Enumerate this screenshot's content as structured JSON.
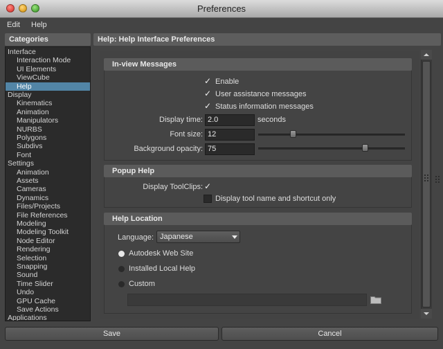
{
  "window": {
    "title": "Preferences"
  },
  "menubar": {
    "items": [
      "Edit",
      "Help"
    ]
  },
  "categories": {
    "header": "Categories",
    "items": [
      {
        "label": "Interface",
        "level": 0
      },
      {
        "label": "Interaction Mode",
        "level": 1
      },
      {
        "label": "UI Elements",
        "level": 1
      },
      {
        "label": "ViewCube",
        "level": 1
      },
      {
        "label": "Help",
        "level": 1,
        "selected": true
      },
      {
        "label": "Display",
        "level": 0
      },
      {
        "label": "Kinematics",
        "level": 1
      },
      {
        "label": "Animation",
        "level": 1
      },
      {
        "label": "Manipulators",
        "level": 1
      },
      {
        "label": "NURBS",
        "level": 1
      },
      {
        "label": "Polygons",
        "level": 1
      },
      {
        "label": "Subdivs",
        "level": 1
      },
      {
        "label": "Font",
        "level": 1
      },
      {
        "label": "Settings",
        "level": 0
      },
      {
        "label": "Animation",
        "level": 1
      },
      {
        "label": "Assets",
        "level": 1
      },
      {
        "label": "Cameras",
        "level": 1
      },
      {
        "label": "Dynamics",
        "level": 1
      },
      {
        "label": "Files/Projects",
        "level": 1
      },
      {
        "label": "File References",
        "level": 1
      },
      {
        "label": "Modeling",
        "level": 1
      },
      {
        "label": "Modeling Toolkit",
        "level": 1
      },
      {
        "label": "Node Editor",
        "level": 1
      },
      {
        "label": "Rendering",
        "level": 1
      },
      {
        "label": "Selection",
        "level": 1
      },
      {
        "label": "Snapping",
        "level": 1
      },
      {
        "label": "Sound",
        "level": 1
      },
      {
        "label": "Time Slider",
        "level": 1
      },
      {
        "label": "Undo",
        "level": 1
      },
      {
        "label": "GPU Cache",
        "level": 1
      },
      {
        "label": "Save Actions",
        "level": 1
      },
      {
        "label": "Applications",
        "level": 0
      }
    ]
  },
  "main": {
    "header": "Help: Help Interface Preferences",
    "inview": {
      "title": "In-view Messages",
      "enable_label": "Enable",
      "enable_checked": true,
      "user_assist_label": "User assistance messages",
      "user_assist_checked": true,
      "status_info_label": "Status information messages",
      "status_info_checked": true,
      "display_time_label": "Display time:",
      "display_time_value": "2.0",
      "display_time_unit": "seconds",
      "font_size_label": "Font size:",
      "font_size_value": "12",
      "font_size_slider_fraction": 0.24,
      "bg_opacity_label": "Background opacity:",
      "bg_opacity_value": "75",
      "bg_opacity_slider_fraction": 0.73
    },
    "popup": {
      "title": "Popup Help",
      "toolclips_label": "Display ToolClips:",
      "toolclips_checked": true,
      "tool_name_label": "Display tool name and shortcut only",
      "tool_name_checked": false
    },
    "location": {
      "title": "Help Location",
      "language_label": "Language:",
      "language_value": "Japanese",
      "options": [
        "Autodesk Web Site",
        "Installed Local Help",
        "Custom"
      ],
      "selected_option": "Autodesk Web Site",
      "custom_path_value": ""
    }
  },
  "footer": {
    "save_label": "Save",
    "cancel_label": "Cancel"
  },
  "icons": {
    "check": "check-icon",
    "folder": "folder-icon",
    "dropdown": "chevron-down-icon"
  },
  "colors": {
    "selection": "#5285a6",
    "background": "#444444",
    "panel_header": "#5d5d5d"
  }
}
